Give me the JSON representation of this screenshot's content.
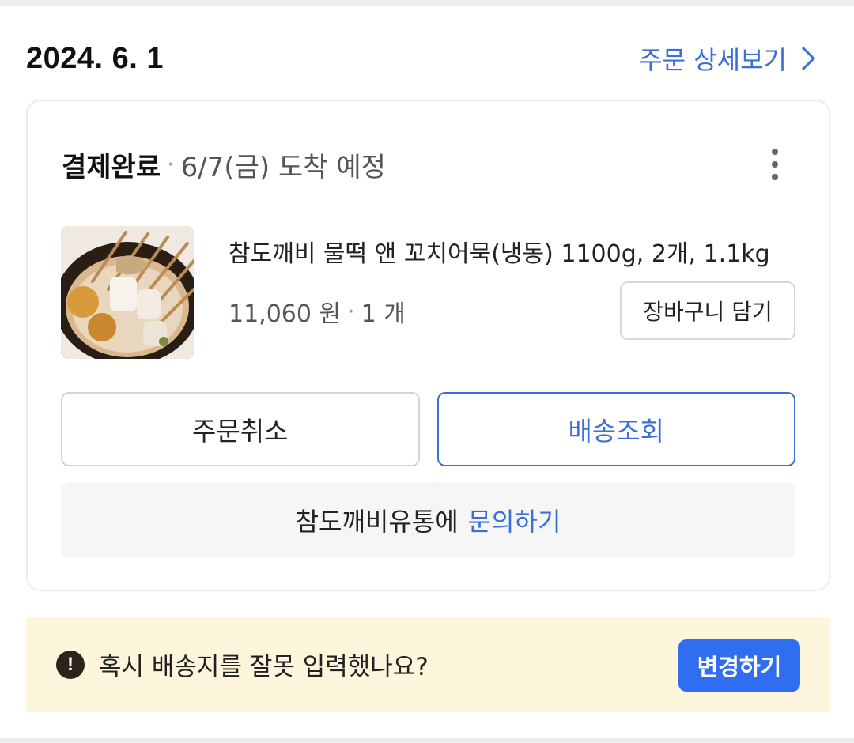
{
  "order": {
    "date": "2024. 6. 1",
    "detail_link": "주문 상세보기",
    "status": "결제완료",
    "separator": "·",
    "eta": "6/7(금) 도착 예정"
  },
  "product": {
    "name": "참도깨비 물떡 앤 꼬치어묵(냉동) 1100g, 2개, 1.1kg",
    "price": "11,060 원",
    "quantity": "1 개",
    "cart_button": "장바구니 담기",
    "image_alt": "oden skewers in broth"
  },
  "actions": {
    "cancel": "주문취소",
    "track": "배송조회"
  },
  "inquiry": {
    "seller": "참도깨비유통에",
    "link": "문의하기"
  },
  "notice": {
    "icon": "!",
    "text": "혹시 배송지를 잘못 입력했나요?",
    "button": "변경하기"
  },
  "colors": {
    "accent": "#3a6fd8",
    "primary_button": "#2f6ef0",
    "notice_bg": "#fdf6dd"
  },
  "icons": [
    "chevron-right-icon",
    "more-vertical-icon",
    "exclamation-circle-icon"
  ]
}
